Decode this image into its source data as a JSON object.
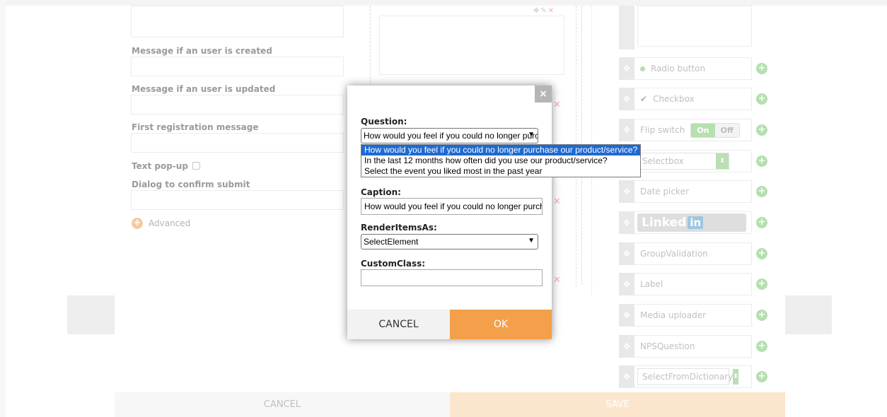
{
  "left_form": {
    "msg_created_label": "Message if an user is created",
    "msg_updated_label": "Message if an user is updated",
    "first_reg_label": "First registration message",
    "text_popup_label": "Text pop-up",
    "dialog_confirm_label": "Dialog to confirm submit",
    "advanced_label": "Advanced"
  },
  "palette": {
    "radio_button": "Radio button",
    "checkbox": "Checkbox",
    "flip_switch": "Flip switch",
    "flip_on": "On",
    "flip_off": "Off",
    "selectbox": "Selectbox",
    "date_picker": "Date picker",
    "linkedin_text": "Linked",
    "linkedin_in": "in",
    "group_validation": "GroupValidation",
    "label": "Label",
    "media_uploader": "Media uploader",
    "nps_question": "NPSQuestion",
    "select_from_dictionary": "SelectFromDictionary"
  },
  "footer": {
    "cancel": "CANCEL",
    "save": "SAVE"
  },
  "modal": {
    "close": "×",
    "question_label": "Question:",
    "question_value": "How would you feel if you could no longer purchase our product/service?",
    "question_options": [
      "How would you feel if you could no longer purchase our product/service?",
      "In the last 12 months how often did you use our product/service?",
      "Select the event you liked most in the past year"
    ],
    "caption_label": "Caption:",
    "caption_value": "How would you feel if you could no longer purchase our product/service?",
    "render_label": "RenderItemsAs:",
    "render_value": "SelectElement",
    "customclass_label": "CustomClass:",
    "customclass_value": "",
    "cancel": "CANCEL",
    "ok": "OK"
  },
  "colors": {
    "accent_orange": "#f4a04a",
    "selection_blue": "#1e6ad1",
    "palette_green": "#b5dfb0"
  }
}
